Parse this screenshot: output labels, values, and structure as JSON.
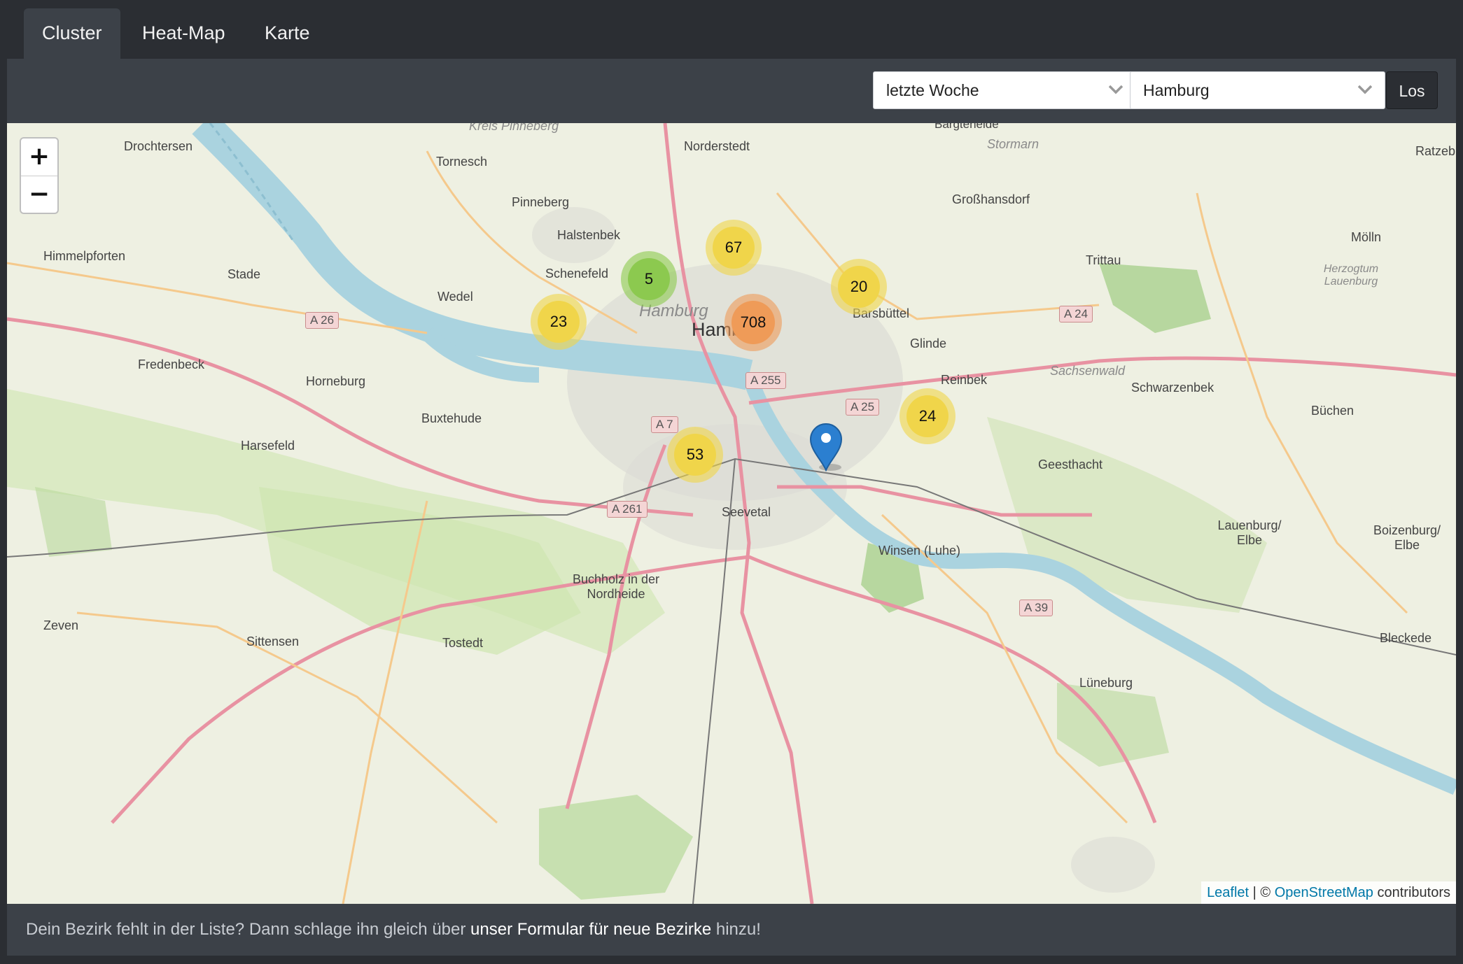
{
  "tabs": [
    {
      "label": "Cluster",
      "active": true
    },
    {
      "label": "Heat-Map",
      "active": false
    },
    {
      "label": "Karte",
      "active": false
    }
  ],
  "filters": {
    "period": {
      "value": "letzte Woche"
    },
    "district": {
      "value": "Hamburg"
    },
    "submit_label": "Los"
  },
  "map": {
    "zoom_in": "+",
    "zoom_out": "−",
    "clusters": [
      {
        "count": "67",
        "color": "#f0d54a"
      },
      {
        "count": "5",
        "color": "#8cc94f"
      },
      {
        "count": "20",
        "color": "#f0d54a"
      },
      {
        "count": "23",
        "color": "#f0d54a"
      },
      {
        "count": "708",
        "color": "#ef9b58"
      },
      {
        "count": "24",
        "color": "#f0d54a"
      },
      {
        "count": "53",
        "color": "#f0d54a"
      }
    ],
    "marker_color": "#2b7fd0",
    "place_labels": [
      "Drochtersen",
      "Tornesch",
      "Norderstedt",
      "Pinneberg",
      "Großhansdorf",
      "Halstenbek",
      "Himmelpforten",
      "Stade",
      "Schenefeld",
      "Trittau",
      "Wedel",
      "Hamburg",
      "Barsbüttel",
      "Glinde",
      "Fredenbeck",
      "Horneburg",
      "Reinbek",
      "Schwarzenbek",
      "Buxtehude",
      "Büchen",
      "Harsefeld",
      "Geesthacht",
      "Seevetal",
      "Lauenburg/ Elbe",
      "Boizenburg/ Elbe",
      "Winsen (Luhe)",
      "Buchholz in der Nordheide",
      "Zeven",
      "Sittensen",
      "Tostedt",
      "Bleckede",
      "Lüneburg",
      "Mölln",
      "Ratzeb"
    ],
    "italic_labels": [
      "Kreis Pinneberg",
      "Stormarn",
      "Herzogtum Lauenburg",
      "Sachsenwald",
      "Hamburg",
      "Bargteheide"
    ],
    "road_shields": [
      "A 26",
      "A 255",
      "A 25",
      "A 24",
      "A 7",
      "A 261",
      "A 39"
    ],
    "attribution": {
      "leaflet": "Leaflet",
      "separator": " | © ",
      "osm": "OpenStreetMap",
      "suffix": " contributors"
    }
  },
  "footer": {
    "prefix": "Dein Bezirk fehlt in der Liste? Dann schlage ihn gleich über ",
    "link": "unser Formular für neue Bezirke",
    "suffix": " hinzu!"
  }
}
